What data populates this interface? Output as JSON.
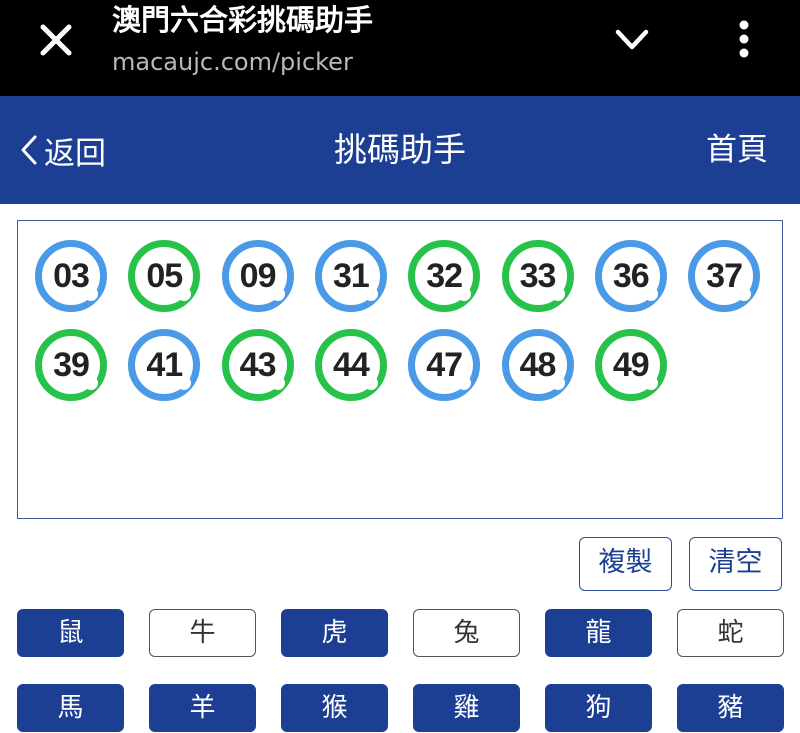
{
  "browser": {
    "title": "澳門六合彩挑碼助手",
    "url": "macaujc.com/picker"
  },
  "header": {
    "back_label": "返回",
    "title": "挑碼助手",
    "home_label": "首頁"
  },
  "colors": {
    "header_bg": "#1c3f93",
    "ball_blue": "#4a9ae8",
    "ball_green": "#27c24a"
  },
  "balls": [
    {
      "number": "03",
      "color": "blue"
    },
    {
      "number": "05",
      "color": "green"
    },
    {
      "number": "09",
      "color": "blue"
    },
    {
      "number": "31",
      "color": "blue"
    },
    {
      "number": "32",
      "color": "green"
    },
    {
      "number": "33",
      "color": "green"
    },
    {
      "number": "36",
      "color": "blue"
    },
    {
      "number": "37",
      "color": "blue"
    },
    {
      "number": "39",
      "color": "green"
    },
    {
      "number": "41",
      "color": "blue"
    },
    {
      "number": "43",
      "color": "green"
    },
    {
      "number": "44",
      "color": "green"
    },
    {
      "number": "47",
      "color": "blue"
    },
    {
      "number": "48",
      "color": "blue"
    },
    {
      "number": "49",
      "color": "green"
    }
  ],
  "actions": {
    "copy_label": "複製",
    "clear_label": "清空"
  },
  "zodiac": [
    {
      "label": "鼠",
      "selected": true
    },
    {
      "label": "牛",
      "selected": false
    },
    {
      "label": "虎",
      "selected": true
    },
    {
      "label": "兔",
      "selected": false
    },
    {
      "label": "龍",
      "selected": true
    },
    {
      "label": "蛇",
      "selected": false
    },
    {
      "label": "馬",
      "selected": true
    },
    {
      "label": "羊",
      "selected": true
    },
    {
      "label": "猴",
      "selected": true
    },
    {
      "label": "雞",
      "selected": true
    },
    {
      "label": "狗",
      "selected": true
    },
    {
      "label": "豬",
      "selected": true
    }
  ]
}
